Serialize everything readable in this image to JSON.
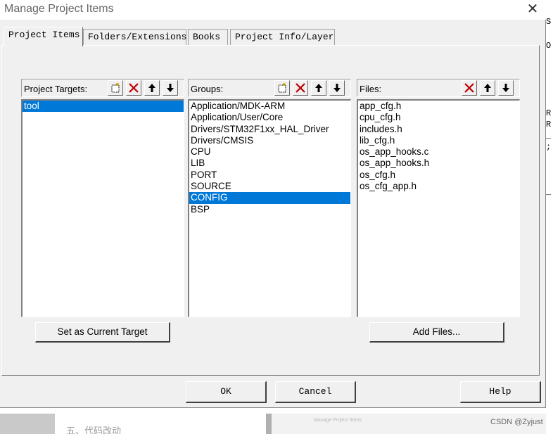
{
  "window": {
    "title": "Manage Project Items",
    "close_glyph": "✕"
  },
  "tabs": [
    {
      "label": "Project Items",
      "active": true
    },
    {
      "label": "Folders/Extensions",
      "active": false
    },
    {
      "label": "Books",
      "active": false
    },
    {
      "label": "Project Info/Layer",
      "active": false
    }
  ],
  "targets": {
    "header": "Project Targets:",
    "items": [
      "tool"
    ],
    "selected": "tool",
    "button": "Set as Current Target"
  },
  "groups": {
    "header": "Groups:",
    "items": [
      "Application/MDK-ARM",
      "Application/User/Core",
      "Drivers/STM32F1xx_HAL_Driver",
      "Drivers/CMSIS",
      "CPU",
      "LIB",
      "PORT",
      "SOURCE",
      "CONFIG",
      "BSP"
    ],
    "selected": "CONFIG"
  },
  "files": {
    "header": "Files:",
    "items": [
      "app_cfg.h",
      "cpu_cfg.h",
      "includes.h",
      "lib_cfg.h",
      "os_app_hooks.c",
      "os_app_hooks.h",
      "os_cfg.h",
      "os_cfg_app.h"
    ],
    "button": "Add Files..."
  },
  "footer": {
    "ok": "OK",
    "cancel": "Cancel",
    "help": "Help"
  },
  "background": {
    "chinese_heading": "五、代码改动",
    "watermark": "CSDN @Zyjust"
  },
  "colors": {
    "selection": "#0078d7",
    "delete_red": "#c00000",
    "dialog_bg": "#f0f0f0"
  }
}
